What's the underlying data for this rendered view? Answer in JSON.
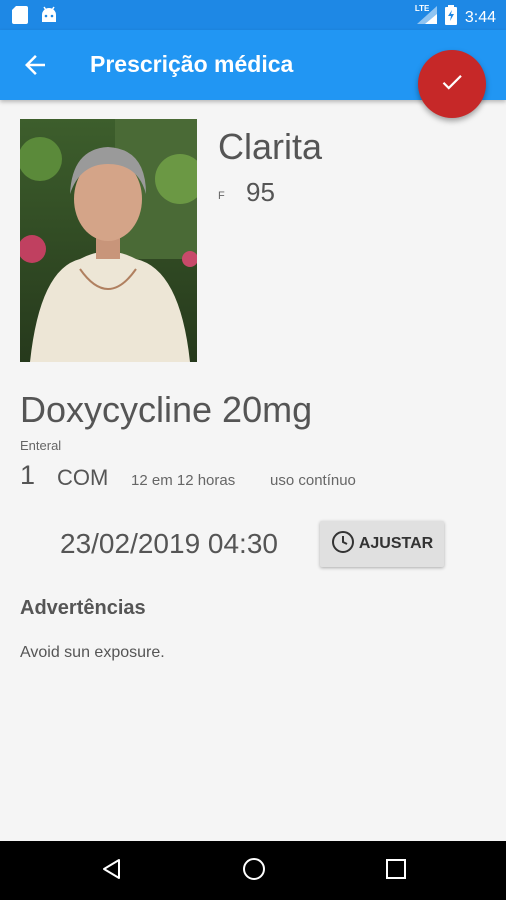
{
  "status_bar": {
    "time": "3:44",
    "network": "LTE"
  },
  "app_bar": {
    "title": "Prescrição médica"
  },
  "patient": {
    "name": "Clarita",
    "sex": "F",
    "age": "95"
  },
  "prescription": {
    "drug": "Doxycycline 20mg",
    "route": "Enteral",
    "quantity": "1",
    "unit": "COM",
    "frequency": "12 em 12 horas",
    "duration": "uso contínuo",
    "datetime": "23/02/2019 04:30",
    "adjust_label": "AJUSTAR"
  },
  "warnings": {
    "title": "Advertências",
    "text": "Avoid sun exposure."
  },
  "colors": {
    "app_bar": "#2196f3",
    "status_bar": "#1e88e5",
    "fab": "#c62828",
    "background": "#f5f5f5"
  },
  "icons": [
    "sd-card-icon",
    "android-icon",
    "signal-icon",
    "battery-icon",
    "back-arrow-icon",
    "check-icon",
    "clock-icon",
    "nav-back-icon",
    "nav-home-icon",
    "nav-recents-icon"
  ]
}
